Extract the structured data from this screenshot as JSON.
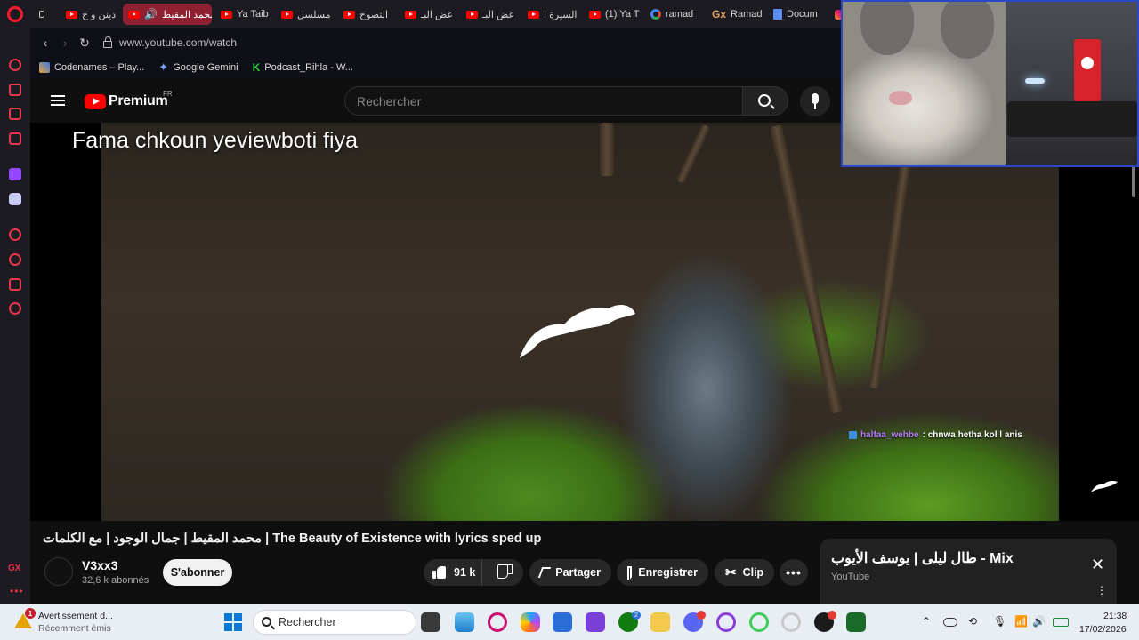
{
  "browser": {
    "tabs": [
      {
        "label": "دينن و ح",
        "icon": "youtube-icon",
        "active": false
      },
      {
        "label": "محمد المقيط",
        "icon": "youtube-icon",
        "active": true
      },
      {
        "label": "Ya Taib",
        "icon": "youtube-icon",
        "active": false
      },
      {
        "label": "مسلسل",
        "icon": "youtube-icon",
        "active": false
      },
      {
        "label": "التصوح",
        "icon": "youtube-icon",
        "active": false
      },
      {
        "label": "غض البـ",
        "icon": "youtube-icon",
        "active": false
      },
      {
        "label": "غض البـ",
        "icon": "youtube-icon",
        "active": false
      },
      {
        "label": "السيرة ا",
        "icon": "youtube-icon",
        "active": false
      },
      {
        "label": "(1) Ya T",
        "icon": "youtube-icon",
        "active": false
      },
      {
        "label": "ramad",
        "icon": "google-icon",
        "active": false
      },
      {
        "label": "Ramad",
        "icon": "gx-icon",
        "active": false
      },
      {
        "label": "Docum",
        "icon": "docs-icon",
        "active": false
      }
    ],
    "url": "www.youtube.com/watch",
    "bookmarks": [
      {
        "label": "Codenames – Play..."
      },
      {
        "label": "Google Gemini"
      },
      {
        "label": "Podcast_Rihla - W..."
      }
    ],
    "sidebar_labels": {
      "gx": "GX",
      "more": "•••"
    }
  },
  "youtube": {
    "brand": "Premium",
    "country": "FR",
    "search_placeholder": "Rechercher",
    "video": {
      "overlay_title": "Fama chkoun yeviewboti fiya",
      "chat_user": "halfaa_wehbe",
      "chat_message": ": chnwa hetha kol l anis",
      "title": "محمد المقيط | جمال الوجود | مع الكلمات | The Beauty of Existence with lyrics sped up",
      "channel_name": "V3xx3",
      "channel_subs": "32,6 k abonnés",
      "subscribe_label": "S'abonner",
      "like_count": "91 k",
      "share_label": "Partager",
      "save_label": "Enregistrer",
      "clip_label": "Clip",
      "more_label": "•••"
    },
    "mix": {
      "title": "طال ليلى | يوسف الأيوب - Mix",
      "subtitle": "YouTube",
      "close": "✕",
      "more": "⋮"
    }
  },
  "taskbar": {
    "notification_title": "Avertissement d...",
    "notification_sub": "Récemment émis",
    "notification_badge": "1",
    "search_placeholder": "Rechercher",
    "xbox_badge": "2",
    "time": "21:38",
    "date": "17/02/2026"
  },
  "colors": {
    "youtube_red": "#ff0000",
    "opera_red": "#ff1b2d",
    "webcam_border": "#2a47c8"
  }
}
